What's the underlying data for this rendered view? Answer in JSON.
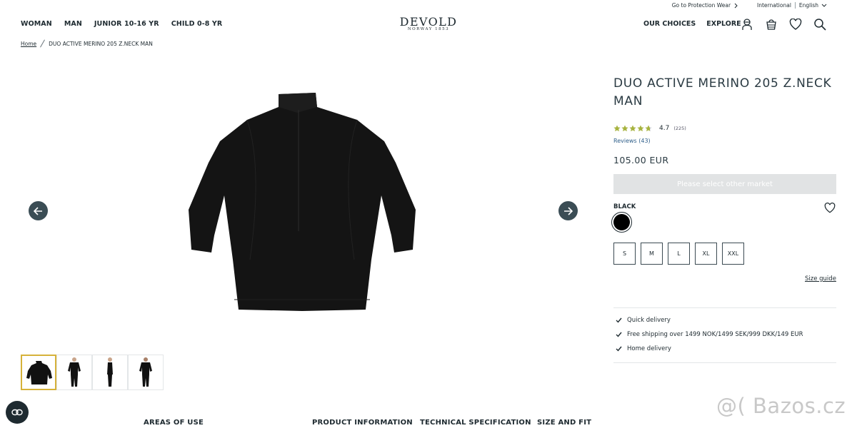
{
  "utility": {
    "protection_link": "Go to Protection Wear",
    "region": "International",
    "language": "English"
  },
  "nav": {
    "left": [
      "WOMAN",
      "MAN",
      "JUNIOR 10-16 YR",
      "CHILD 0-8 YR"
    ],
    "right": [
      "OUR CHOICES",
      "EXPLORE"
    ]
  },
  "logo": {
    "brand": "DEVOLD",
    "tagline": "NORWAY 1853"
  },
  "breadcrumb": {
    "home": "Home",
    "current": "DUO ACTIVE MERINO 205 Z.NECK MAN"
  },
  "product": {
    "title": "DUO ACTIVE MERINO 205 Z.NECK MAN",
    "rating": "4.7",
    "rating_value": 4.7,
    "rating_count": "(225)",
    "reviews_link": "Reviews (43)",
    "price": "105.00 EUR",
    "market_button": "Please select other market",
    "color_label": "BLACK",
    "sizes": [
      "S",
      "M",
      "L",
      "XL",
      "XXL"
    ],
    "size_guide": "Size guide",
    "usps": [
      "Quick delivery",
      "Free shipping over 1499 NOK/1499 SEK/999 DKK/149 EUR",
      "Home delivery"
    ]
  },
  "tabs": [
    "AREAS OF USE",
    "PRODUCT INFORMATION",
    "TECHNICAL SPECIFICATION",
    "SIZE AND FIT"
  ],
  "watermark": "@( Bazos.cz",
  "colors": {
    "text": "#1e2a30",
    "arrow_bg": "#3b4d55",
    "star": "#a7b33f",
    "disabled_button": "#e1e3e4",
    "thumb_active": "#d6b23a"
  }
}
